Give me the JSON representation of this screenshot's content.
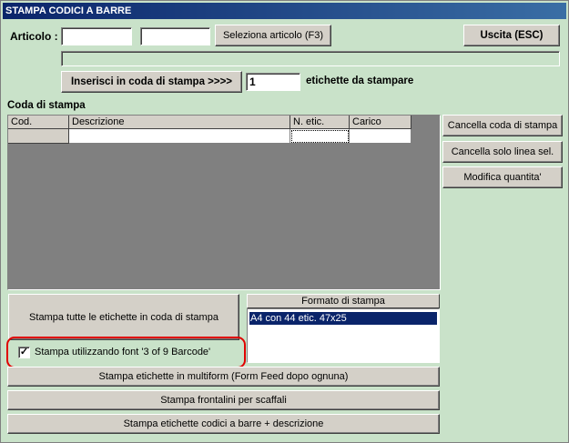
{
  "window": {
    "title": "STAMPA CODICI A BARRE"
  },
  "header": {
    "articolo_label": "Articolo :",
    "articolo_code_value": "",
    "articolo_extra_value": "",
    "select_button": "Seleziona articolo (F3)",
    "exit_button": "Uscita (ESC)",
    "description_value": ""
  },
  "queue_controls": {
    "insert_button": "Inserisci in coda di stampa >>>>",
    "quantity_value": "1",
    "quantity_suffix": "etichette da stampare"
  },
  "queue": {
    "title": "Coda di stampa",
    "columns": [
      "Cod.",
      "Descrizione",
      "N. etic.",
      "Carico"
    ],
    "rows": [
      [
        "",
        "",
        "",
        ""
      ]
    ]
  },
  "side_buttons": {
    "clear_queue": "Cancella coda di stampa",
    "clear_selected": "Cancella solo linea sel.",
    "modify_quantity": "Modifica quantita'"
  },
  "print": {
    "print_all_button": "Stampa tutte le etichette in coda di stampa",
    "font_checkbox_label": "Stampa utilizzando font '3 of 9 Barcode'",
    "font_checkbox_checked": "✓",
    "format_header": "Formato di stampa",
    "format_options": [
      "A4 con 44 etic. 47x25"
    ],
    "multiform_button": "Stampa etichette in multiform (Form Feed dopo ognuna)",
    "shelf_button": "Stampa frontalini per scaffali",
    "barcode_desc_button": "Stampa etichette codici a barre + descrizione"
  },
  "colors": {
    "highlight": "#e00000",
    "selection": "#0a246a",
    "window_bg": "#c9e2c9"
  }
}
